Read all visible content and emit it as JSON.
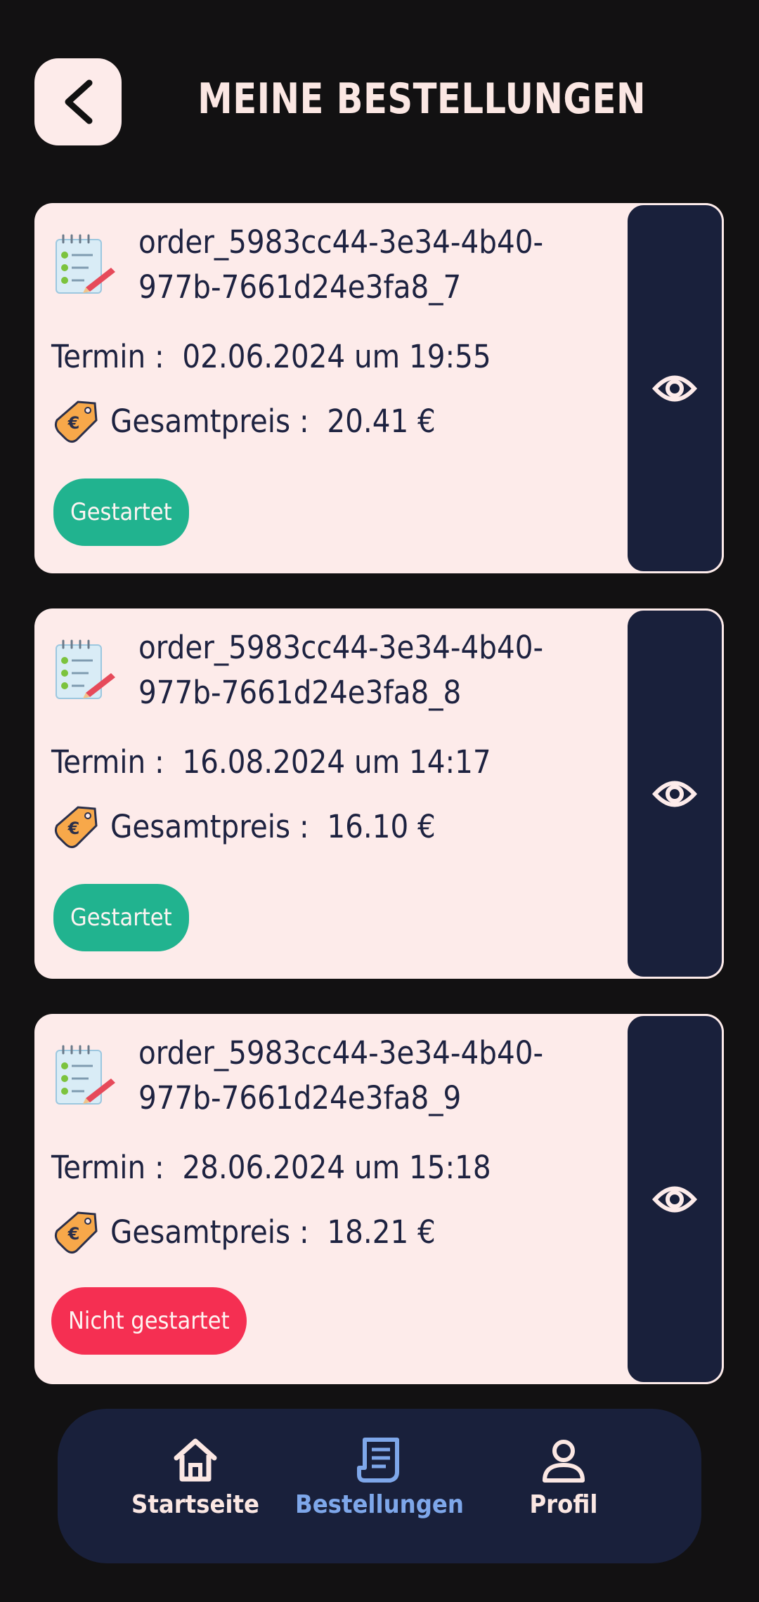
{
  "header": {
    "title": "MEINE BESTELLUNGEN"
  },
  "orders": [
    {
      "id": "order_5983cc44-3e34-4b40-977b-7661d24e3fa8_7",
      "termin_label": "Termin :",
      "termin": "02.06.2024 um 19:55",
      "price_label": "Gesamtpreis :",
      "price": "20.41 €",
      "status": "Gestartet",
      "status_type": "started"
    },
    {
      "id": "order_5983cc44-3e34-4b40-977b-7661d24e3fa8_8",
      "termin_label": "Termin :",
      "termin": "16.08.2024 um 14:17",
      "price_label": "Gesamtpreis :",
      "price": "16.10 €",
      "status": "Gestartet",
      "status_type": "started"
    },
    {
      "id": "order_5983cc44-3e34-4b40-977b-7661d24e3fa8_9",
      "termin_label": "Termin :",
      "termin": "28.06.2024 um 15:18",
      "price_label": "Gesamtpreis :",
      "price": "18.21 €",
      "status": "Nicht gestartet",
      "status_type": "not-started"
    }
  ],
  "nav": {
    "items": [
      {
        "label": "Startseite",
        "icon": "home-icon",
        "active": false
      },
      {
        "label": "Bestellungen",
        "icon": "receipt-icon",
        "active": true
      },
      {
        "label": "Profil",
        "icon": "user-icon",
        "active": false
      }
    ]
  },
  "colors": {
    "background": "#121112",
    "card": "#fdebea",
    "navy": "#19203b",
    "status_started": "#21b38f",
    "status_not_started": "#f52f52",
    "nav_active": "#7ea7ea"
  }
}
